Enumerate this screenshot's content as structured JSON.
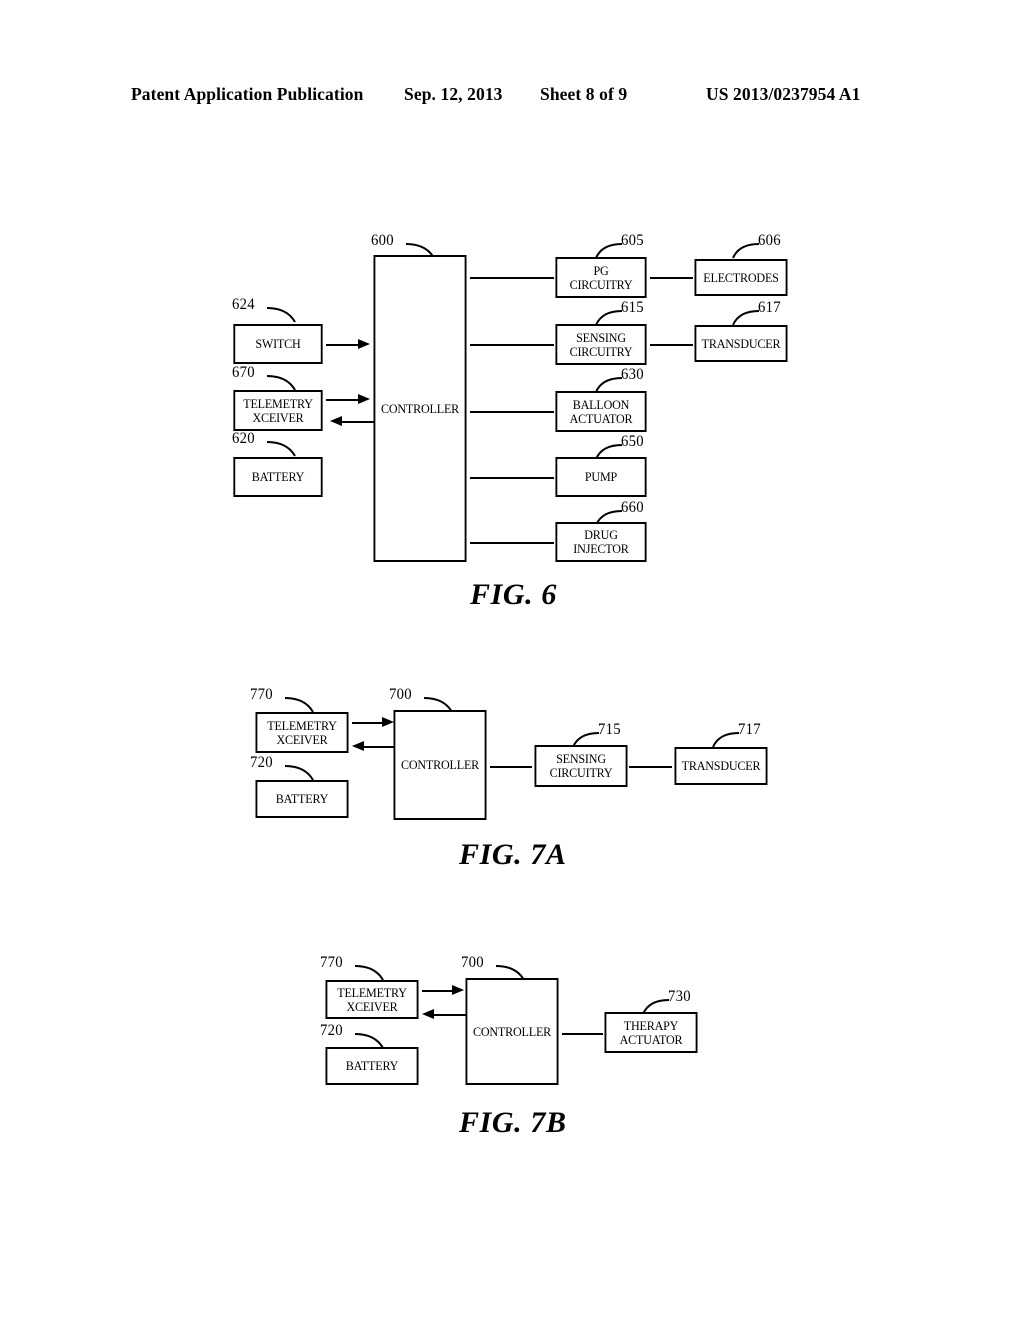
{
  "header": {
    "publication": "Patent Application Publication",
    "date": "Sep. 12, 2013",
    "sheet": "Sheet 8 of 9",
    "patent_number": "US 2013/0237954 A1"
  },
  "figures": [
    {
      "caption": "FIG. 6",
      "blocks": [
        {
          "ref": "600",
          "label": "CONTROLLER"
        },
        {
          "ref": "624",
          "label": "SWITCH"
        },
        {
          "ref": "670",
          "label": "TELEMETRY\nXCEIVER"
        },
        {
          "ref": "620",
          "label": "BATTERY"
        },
        {
          "ref": "605",
          "label": "PG\nCIRCUITRY"
        },
        {
          "ref": "606",
          "label": "ELECTRODES"
        },
        {
          "ref": "615",
          "label": "SENSING\nCIRCUITRY"
        },
        {
          "ref": "617",
          "label": "TRANSDUCER"
        },
        {
          "ref": "630",
          "label": "BALLOON\nACTUATOR"
        },
        {
          "ref": "650",
          "label": "PUMP"
        },
        {
          "ref": "660",
          "label": "DRUG\nINJECTOR"
        }
      ]
    },
    {
      "caption": "FIG. 7A",
      "blocks": [
        {
          "ref": "770",
          "label": "TELEMETRY\nXCEIVER"
        },
        {
          "ref": "720",
          "label": "BATTERY"
        },
        {
          "ref": "700",
          "label": "CONTROLLER"
        },
        {
          "ref": "715",
          "label": "SENSING\nCIRCUITRY"
        },
        {
          "ref": "717",
          "label": "TRANSDUCER"
        }
      ]
    },
    {
      "caption": "FIG. 7B",
      "blocks": [
        {
          "ref": "770",
          "label": "TELEMETRY\nXCEIVER"
        },
        {
          "ref": "720",
          "label": "BATTERY"
        },
        {
          "ref": "700",
          "label": "CONTROLLER"
        },
        {
          "ref": "730",
          "label": "THERAPY\nACTUATOR"
        }
      ]
    }
  ]
}
